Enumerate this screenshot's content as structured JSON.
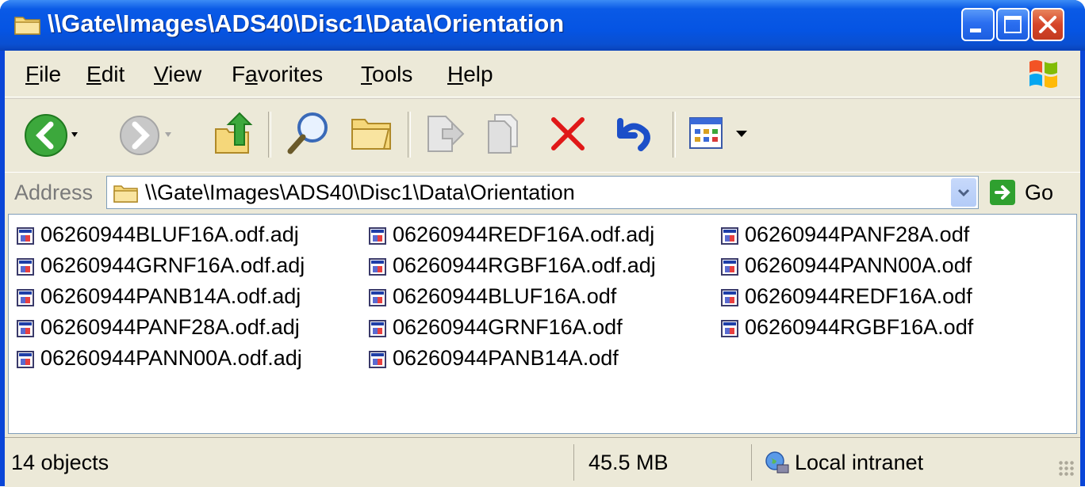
{
  "window": {
    "title": "\\\\Gate\\Images\\ADS40\\Disc1\\Data\\Orientation"
  },
  "menu": [
    {
      "label": "File",
      "accel": "F",
      "rest": "ile"
    },
    {
      "label": "Edit",
      "accel": "E",
      "rest": "dit"
    },
    {
      "label": "View",
      "accel": "V",
      "rest": "iew"
    },
    {
      "label": "Favorites",
      "pre": "F",
      "accel": "a",
      "rest": "vorites"
    },
    {
      "label": "Tools",
      "accel": "T",
      "rest": "ools"
    },
    {
      "label": "Help",
      "accel": "H",
      "rest": "elp"
    }
  ],
  "toolbar": {
    "icons": [
      "back-icon",
      "dropdown-arrow-icon",
      "forward-icon",
      "dropdown-arrow-icon",
      "up-folder-icon",
      "search-icon",
      "folders-icon",
      "move-to-icon",
      "copy-to-icon",
      "delete-icon",
      "undo-icon",
      "views-icon"
    ]
  },
  "address": {
    "label": "Address",
    "value": "\\\\Gate\\Images\\ADS40\\Disc1\\Data\\Orientation",
    "go_label": "Go"
  },
  "files": [
    [
      "06260944BLUF16A.odf.adj",
      "06260944GRNF16A.odf.adj",
      "06260944PANB14A.odf.adj",
      "06260944PANF28A.odf.adj",
      "06260944PANN00A.odf.adj"
    ],
    [
      "06260944REDF16A.odf.adj",
      "06260944RGBF16A.odf.adj",
      "06260944BLUF16A.odf",
      "06260944GRNF16A.odf",
      "06260944PANB14A.odf"
    ],
    [
      "06260944PANF28A.odf",
      "06260944PANN00A.odf",
      "06260944REDF16A.odf",
      "06260944RGBF16A.odf"
    ]
  ],
  "status": {
    "objects": "14 objects",
    "size": "45.5 MB",
    "zone": "Local intranet"
  },
  "colors": {
    "titlebar": "#0554e3",
    "chrome": "#ece9d8",
    "close_button": "#d6452a"
  }
}
